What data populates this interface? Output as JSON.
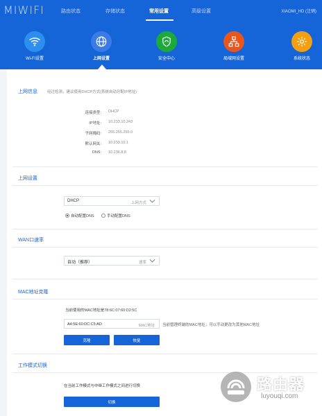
{
  "header": {
    "logo": "MIWIFI",
    "nav": [
      "路由状态",
      "存储状态",
      "常用设置",
      "高级设置"
    ],
    "active_nav": "常用设置",
    "user": "XIAOMI_HD (注销)"
  },
  "tabs": [
    {
      "label": "Wi-Fi设置",
      "icon": "wifi-icon",
      "color": "#2e8ef0"
    },
    {
      "label": "上网设置",
      "icon": "globe-icon",
      "color": "#3b7be8"
    },
    {
      "label": "安全中心",
      "icon": "shield-icon",
      "color": "#1eaa3a"
    },
    {
      "label": "局域网设置",
      "icon": "network-icon",
      "color": "#e8561e"
    },
    {
      "label": "系统状态",
      "icon": "gear-icon",
      "color": "#f2a012"
    }
  ],
  "internet_info": {
    "title": "上网信息",
    "hint": "经过检测，建议使用DHCP方式(系统自动分配IP地址)",
    "rows": [
      {
        "label": "连接类型:",
        "value": "DHCP"
      },
      {
        "label": "IP地址:",
        "value": "10.233.10.243"
      },
      {
        "label": "子网掩码:",
        "value": "255.255.255.0"
      },
      {
        "label": "默认网关:",
        "value": "10.233.10.1"
      },
      {
        "label": "DNS:",
        "value": "10.236.8.8"
      }
    ]
  },
  "internet_settings": {
    "title": "上网设置",
    "mode_value": "DHCP",
    "mode_hint": "上网方式",
    "dns_auto": "自动配置DNS",
    "dns_manual": "手动配置DNS"
  },
  "wan": {
    "title": "WAN口速率",
    "value": "自动（推荐）",
    "hint": "速率"
  },
  "mac": {
    "title": "MAC地址克隆",
    "current": "当前使用的MAC地址是78:6C:07:60:D2:5C",
    "input_value": "A4:5E:60:DC:C5:AD",
    "input_hint": "MAC地址",
    "note": "当前管理终端的MAC地址，可以手动更改为其他MAC地址",
    "clone_button": "克隆",
    "restore_button": "恢复"
  },
  "work_mode": {
    "title": "工作模式切换",
    "text": "在当前工作模式与中继工作模式之间进行切换",
    "switch_button": "切换"
  },
  "watermark": {
    "title": "路由器",
    "subtitle": "luyouqi.com"
  },
  "colors": {
    "primary": "#1565d8",
    "background": "#f2f4f7"
  }
}
